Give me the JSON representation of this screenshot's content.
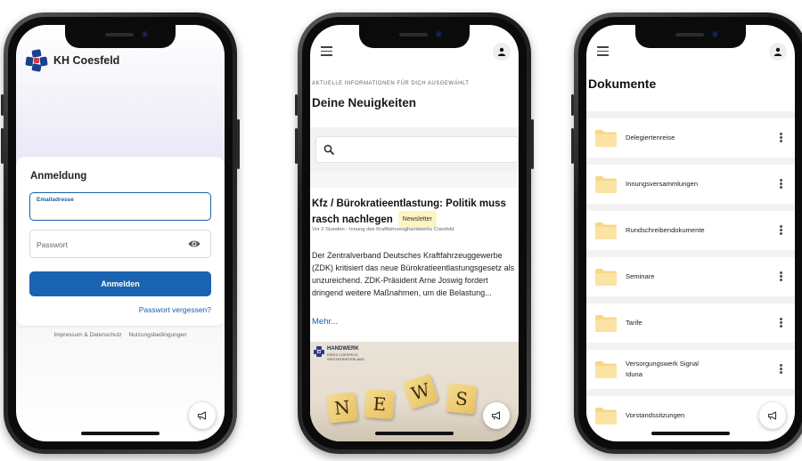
{
  "login": {
    "brand": "KH Coesfeld",
    "card_title": "Anmeldung",
    "email_label": "Emailadresse",
    "password_placeholder": "Passwort",
    "login_button": "Anmelden",
    "forgot_link": "Passwort vergessen?",
    "footer_impressum": "Impressum & Datenschutz",
    "footer_terms": "Nutzungsbedingungen"
  },
  "news": {
    "eyebrow": "AKTUELLE INFORMATIONEN FÜR DICH AUSGEWÄHLT",
    "heading": "Deine Neuigkeiten",
    "article_title": "Kfz / Bürokratieentlastung: Politik muss rasch nachlegen",
    "article_tag": "Newsletter",
    "article_meta": "Vor 2 Stunden - Innung des Kraftfahrzeughandwerks Coesfeld",
    "article_body": "Der Zentralverband Deutsches Kraftfahrzeuggewerbe (ZDK) kritisiert das neue Bürokratieentlastungsgesetz als unzureichend. ZDK-Präsident Arne Joswig fordert dringend weitere Maßnahmen, um die Belastung...",
    "more_link": "Mehr...",
    "image_logo_title": "HANDWERK",
    "image_logo_line1": "KREIS COESFELD",
    "image_logo_line2": "WESTMÜNSTERLAND",
    "image_letters": [
      "N",
      "E",
      "W",
      "S"
    ]
  },
  "documents": {
    "title": "Dokumente",
    "items": [
      {
        "line1": "Delegiertenreise",
        "line2": ""
      },
      {
        "line1": "Innungsversammlungen",
        "line2": ""
      },
      {
        "line1": "Rundschreibendokumente",
        "line2": ""
      },
      {
        "line1": "Seminare",
        "line2": ""
      },
      {
        "line1": "Tarife",
        "line2": ""
      },
      {
        "line1": "Versorgungswerk Signal",
        "line2": "Iduna"
      },
      {
        "line1": "Vorstandssitzungen",
        "line2": ""
      }
    ]
  },
  "colors": {
    "primary": "#1a63b0",
    "tag_bg": "#fff3c4",
    "folder": "#f7d889"
  }
}
